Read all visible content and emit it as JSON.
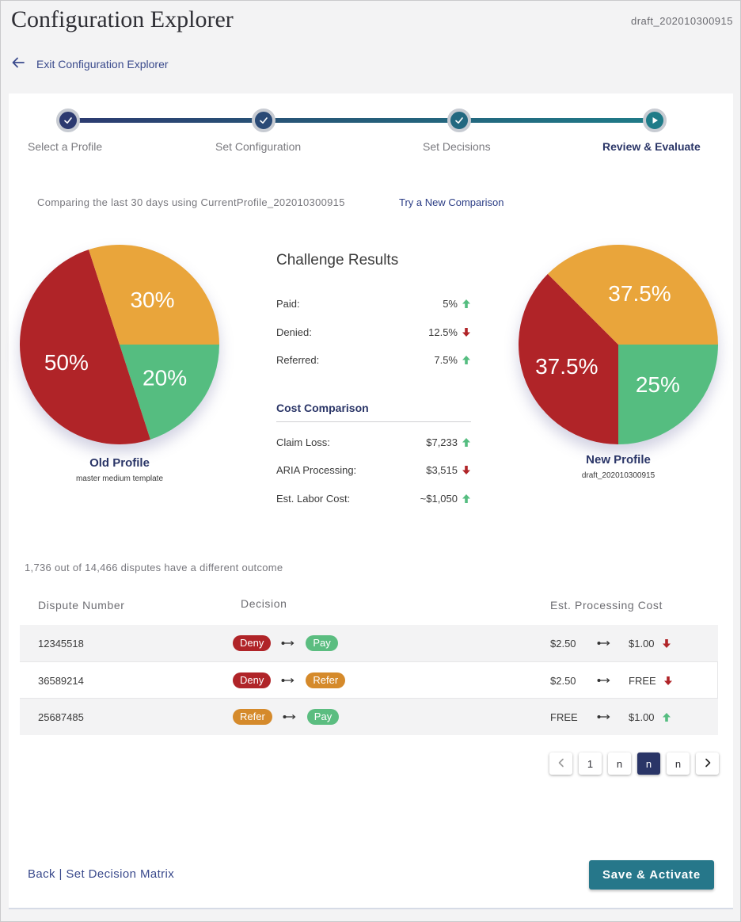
{
  "header": {
    "title": "Configuration Explorer",
    "draft_id": "draft_202010300915",
    "exit_label": "Exit Configuration Explorer"
  },
  "stepper": {
    "steps": [
      {
        "label": "Select a Profile",
        "status": "complete"
      },
      {
        "label": "Set Configuration",
        "status": "complete"
      },
      {
        "label": "Set Decisions",
        "status": "complete"
      },
      {
        "label": "Review & Evaluate",
        "status": "current"
      }
    ]
  },
  "comparison": {
    "text": "Comparing the last 30 days using CurrentProfile_202010300915",
    "link": "Try a New Comparison"
  },
  "old_profile": {
    "name": "Old Profile",
    "subtitle": "master medium template",
    "slices": [
      {
        "label": "Paid",
        "value": 20,
        "text": "20%",
        "color": "#55bd80"
      },
      {
        "label": "Denied",
        "value": 50,
        "text": "50%",
        "color": "#b02428"
      },
      {
        "label": "Referred",
        "value": 30,
        "text": "30%",
        "color": "#e9a53b"
      }
    ]
  },
  "new_profile": {
    "name": "New Profile",
    "subtitle": "draft_202010300915",
    "slices": [
      {
        "label": "Paid",
        "value": 25,
        "text": "25%",
        "color": "#55bd80"
      },
      {
        "label": "Denied",
        "value": 37.5,
        "text": "37.5%",
        "color": "#b02428"
      },
      {
        "label": "Referred",
        "value": 37.5,
        "text": "37.5%",
        "color": "#e9a53b"
      }
    ]
  },
  "challenge_results": {
    "title": "Challenge Results",
    "rows": [
      {
        "label": "Paid:",
        "value": "5%",
        "direction": "up"
      },
      {
        "label": "Denied:",
        "value": "12.5%",
        "direction": "down"
      },
      {
        "label": "Referred:",
        "value": "7.5%",
        "direction": "up"
      }
    ]
  },
  "cost_comparison": {
    "title": "Cost Comparison",
    "rows": [
      {
        "label": "Claim Loss:",
        "value": "$7,233",
        "direction": "up"
      },
      {
        "label": "ARIA Processing:",
        "value": "$3,515",
        "direction": "down"
      },
      {
        "label": "Est. Labor Cost:",
        "value": "~$1,050",
        "direction": "up"
      }
    ]
  },
  "disputes": {
    "summary": "1,736 out of 14,466 disputes have a different outcome",
    "headers": {
      "number": "Dispute Number",
      "decision": "Decision",
      "cost": "Est. Processing Cost"
    },
    "rows": [
      {
        "number": "12345518",
        "from": "Deny",
        "to": "Pay",
        "cost_from": "$2.50",
        "cost_to": "$1.00",
        "direction": "down"
      },
      {
        "number": "36589214",
        "from": "Deny",
        "to": "Refer",
        "cost_from": "$2.50",
        "cost_to": "FREE",
        "direction": "down"
      },
      {
        "number": "25687485",
        "from": "Refer",
        "to": "Pay",
        "cost_from": "FREE",
        "cost_to": "$1.00",
        "direction": "up"
      }
    ]
  },
  "pagination": {
    "pages": [
      "1",
      "n",
      "n",
      "n"
    ],
    "active_index": 2
  },
  "footer": {
    "back_label": "Back | Set Decision Matrix",
    "save_label": "Save & Activate"
  },
  "colors": {
    "primary": "#2a3567",
    "accent": "#26778a",
    "up": "#55bd80",
    "down": "#b02428"
  }
}
